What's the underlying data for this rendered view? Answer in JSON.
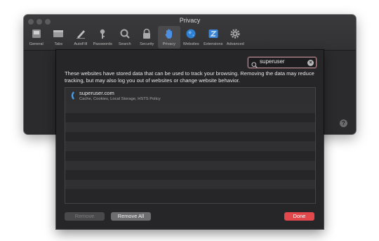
{
  "window": {
    "title": "Privacy"
  },
  "toolbar": {
    "items": [
      {
        "label": "General",
        "icon": "general-icon"
      },
      {
        "label": "Tabs",
        "icon": "tabs-icon"
      },
      {
        "label": "AutoFill",
        "icon": "autofill-icon"
      },
      {
        "label": "Passwords",
        "icon": "key-icon"
      },
      {
        "label": "Search",
        "icon": "search-icon"
      },
      {
        "label": "Security",
        "icon": "lock-icon"
      },
      {
        "label": "Privacy",
        "icon": "hand-icon",
        "selected": true
      },
      {
        "label": "Websites",
        "icon": "globe-icon"
      },
      {
        "label": "Extensions",
        "icon": "puzzle-icon"
      },
      {
        "label": "Advanced",
        "icon": "gear-icon"
      }
    ]
  },
  "help": {
    "label": "?"
  },
  "sheet": {
    "search": {
      "value": "superuser"
    },
    "description": "These websites have stored data that can be used to track your browsing. Removing the data may reduce tracking, but may also log you out of websites or change website behavior.",
    "websites": [
      {
        "name": "superuser.com",
        "detail": "Cache, Cookies, Local Storage, HSTS Policy"
      }
    ],
    "buttons": {
      "remove": "Remove",
      "remove_all": "Remove All",
      "done": "Done"
    }
  },
  "colors": {
    "accent_done": "#e2474c",
    "selected_tab": "#4a4a4d",
    "sheet_bg": "#262628"
  }
}
